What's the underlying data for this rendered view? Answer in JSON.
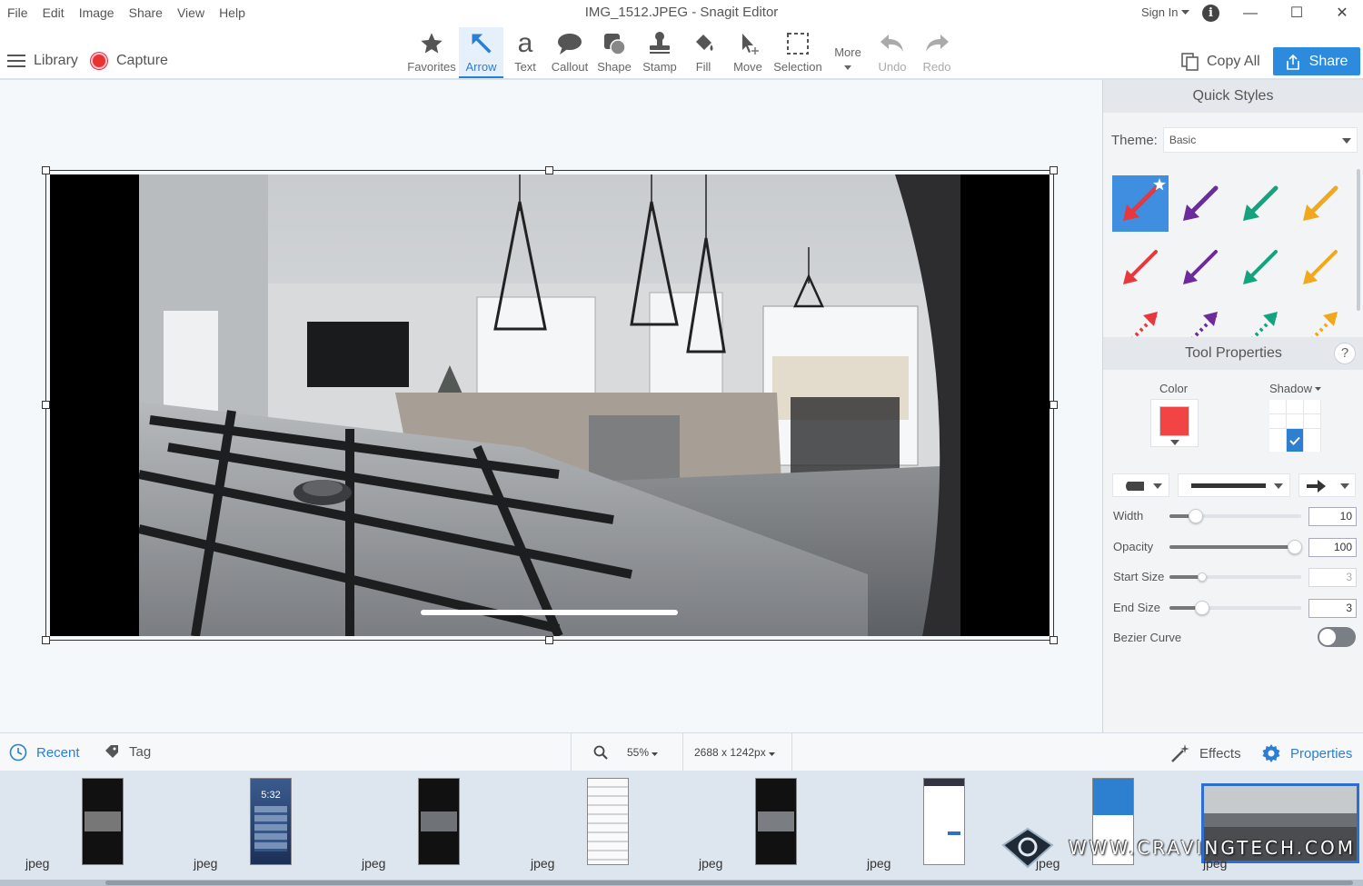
{
  "window": {
    "title": "IMG_1512.JPEG - Snagit Editor",
    "menu": [
      "File",
      "Edit",
      "Image",
      "Share",
      "View",
      "Help"
    ],
    "sign_in": "Sign In",
    "controls": {
      "minimize": "—",
      "maximize": "☐",
      "close": "✕"
    }
  },
  "toolbar": {
    "library": "Library",
    "capture": "Capture",
    "tools": [
      "Favorites",
      "Arrow",
      "Text",
      "Callout",
      "Shape",
      "Stamp",
      "Fill",
      "Move",
      "Selection",
      "More",
      "Undo",
      "Redo"
    ],
    "active_tool": "Arrow",
    "copy_all": "Copy All",
    "share": "Share"
  },
  "quick_styles": {
    "title": "Quick Styles",
    "theme_label": "Theme:",
    "theme_value": "Basic",
    "arrow_colors": [
      "#e8383d",
      "#6c2a9c",
      "#15a37f",
      "#f2a81c"
    ],
    "selected_color": "#3f8ee0"
  },
  "tool_properties": {
    "title": "Tool Properties",
    "help": "?",
    "color_label": "Color",
    "color_value": "#f24444",
    "shadow_label": "Shadow",
    "width_label": "Width",
    "width_value": "10",
    "width_fraction": 0.2,
    "opacity_label": "Opacity",
    "opacity_value": "100",
    "opacity_fraction": 0.95,
    "start_size_label": "Start Size",
    "start_size_value": "3",
    "start_size_fraction": 0.25,
    "end_size_label": "End Size",
    "end_size_value": "3",
    "end_size_fraction": 0.25,
    "bezier_label": "Bezier Curve",
    "bezier_on": false
  },
  "bottom_bar": {
    "recent": "Recent",
    "tag": "Tag",
    "zoom": "55%",
    "dimensions": "2688 x 1242px",
    "effects": "Effects",
    "properties": "Properties"
  },
  "tray": {
    "items": [
      "jpeg",
      "jpeg",
      "jpeg",
      "jpeg",
      "jpeg",
      "jpeg",
      "jpeg",
      "jpeg"
    ],
    "phone_time": "5:32"
  },
  "watermark": "WWW.CRAVINGTECH.COM"
}
